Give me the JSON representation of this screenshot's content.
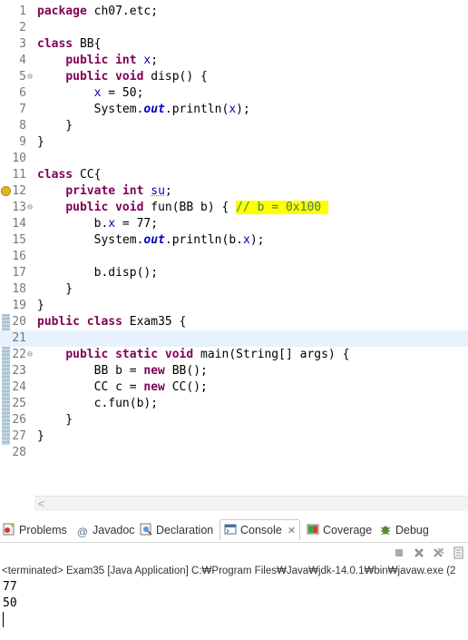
{
  "editor": {
    "lines": [
      {
        "n": "1",
        "tokens": [
          {
            "t": "package",
            "c": "kw"
          },
          {
            "t": " ch07.etc;",
            "c": ""
          }
        ]
      },
      {
        "n": "2",
        "tokens": []
      },
      {
        "n": "3",
        "tokens": [
          {
            "t": "class",
            "c": "kw"
          },
          {
            "t": " BB{",
            "c": ""
          }
        ]
      },
      {
        "n": "4",
        "tokens": [
          {
            "t": "    ",
            "c": ""
          },
          {
            "t": "public",
            "c": "kw"
          },
          {
            "t": " ",
            "c": ""
          },
          {
            "t": "int",
            "c": "kw"
          },
          {
            "t": " ",
            "c": ""
          },
          {
            "t": "x",
            "c": "fld"
          },
          {
            "t": ";",
            "c": ""
          }
        ]
      },
      {
        "n": "5",
        "fold": true,
        "tokens": [
          {
            "t": "    ",
            "c": ""
          },
          {
            "t": "public",
            "c": "kw"
          },
          {
            "t": " ",
            "c": ""
          },
          {
            "t": "void",
            "c": "kw"
          },
          {
            "t": " disp() {",
            "c": ""
          }
        ]
      },
      {
        "n": "6",
        "tokens": [
          {
            "t": "        ",
            "c": ""
          },
          {
            "t": "x",
            "c": "fld"
          },
          {
            "t": " = 50;",
            "c": ""
          }
        ]
      },
      {
        "n": "7",
        "tokens": [
          {
            "t": "        System.",
            "c": ""
          },
          {
            "t": "out",
            "c": "sfld"
          },
          {
            "t": ".println(",
            "c": ""
          },
          {
            "t": "x",
            "c": "fld"
          },
          {
            "t": ");",
            "c": ""
          }
        ]
      },
      {
        "n": "8",
        "tokens": [
          {
            "t": "    }",
            "c": ""
          }
        ]
      },
      {
        "n": "9",
        "tokens": [
          {
            "t": "}",
            "c": ""
          }
        ]
      },
      {
        "n": "10",
        "tokens": []
      },
      {
        "n": "11",
        "tokens": [
          {
            "t": "class",
            "c": "kw"
          },
          {
            "t": " CC{",
            "c": ""
          }
        ]
      },
      {
        "n": "12",
        "warn": true,
        "tokens": [
          {
            "t": "    ",
            "c": ""
          },
          {
            "t": "private",
            "c": "kw"
          },
          {
            "t": " ",
            "c": ""
          },
          {
            "t": "int",
            "c": "kw"
          },
          {
            "t": " ",
            "c": ""
          },
          {
            "t": "su",
            "c": "fld unused"
          },
          {
            "t": ";",
            "c": ""
          }
        ]
      },
      {
        "n": "13",
        "fold": true,
        "tokens": [
          {
            "t": "    ",
            "c": ""
          },
          {
            "t": "public",
            "c": "kw"
          },
          {
            "t": " ",
            "c": ""
          },
          {
            "t": "void",
            "c": "kw"
          },
          {
            "t": " fun(BB b) { ",
            "c": ""
          },
          {
            "t": "// b = 0x100 ",
            "c": "cmt"
          }
        ]
      },
      {
        "n": "14",
        "tokens": [
          {
            "t": "        b.",
            "c": ""
          },
          {
            "t": "x",
            "c": "fld"
          },
          {
            "t": " = 77;",
            "c": ""
          }
        ]
      },
      {
        "n": "15",
        "tokens": [
          {
            "t": "        System.",
            "c": ""
          },
          {
            "t": "out",
            "c": "sfld"
          },
          {
            "t": ".println(b.",
            "c": ""
          },
          {
            "t": "x",
            "c": "fld"
          },
          {
            "t": ");",
            "c": ""
          }
        ]
      },
      {
        "n": "16",
        "tokens": []
      },
      {
        "n": "17",
        "tokens": [
          {
            "t": "        b.disp();",
            "c": ""
          }
        ]
      },
      {
        "n": "18",
        "tokens": [
          {
            "t": "    }",
            "c": ""
          }
        ]
      },
      {
        "n": "19",
        "tokens": [
          {
            "t": "}",
            "c": ""
          }
        ]
      },
      {
        "n": "20",
        "tokens": [
          {
            "t": "public",
            "c": "kw"
          },
          {
            "t": " ",
            "c": ""
          },
          {
            "t": "class",
            "c": "kw"
          },
          {
            "t": " Exam35 {",
            "c": ""
          }
        ]
      },
      {
        "n": "21",
        "current": true,
        "tokens": []
      },
      {
        "n": "22",
        "fold": true,
        "tokens": [
          {
            "t": "    ",
            "c": ""
          },
          {
            "t": "public",
            "c": "kw"
          },
          {
            "t": " ",
            "c": ""
          },
          {
            "t": "static",
            "c": "kw"
          },
          {
            "t": " ",
            "c": ""
          },
          {
            "t": "void",
            "c": "kw"
          },
          {
            "t": " main(String[] args) {",
            "c": ""
          }
        ]
      },
      {
        "n": "23",
        "tokens": [
          {
            "t": "        BB b = ",
            "c": ""
          },
          {
            "t": "new",
            "c": "kw"
          },
          {
            "t": " BB();",
            "c": ""
          }
        ]
      },
      {
        "n": "24",
        "tokens": [
          {
            "t": "        CC c = ",
            "c": ""
          },
          {
            "t": "new",
            "c": "kw"
          },
          {
            "t": " CC();",
            "c": ""
          }
        ]
      },
      {
        "n": "25",
        "tokens": [
          {
            "t": "        c.fun(b);",
            "c": ""
          }
        ]
      },
      {
        "n": "26",
        "tokens": [
          {
            "t": "    }",
            "c": ""
          }
        ]
      },
      {
        "n": "27",
        "tokens": [
          {
            "t": "}",
            "c": ""
          }
        ]
      },
      {
        "n": "28",
        "tokens": []
      }
    ],
    "scroll_left": "<"
  },
  "tabs": {
    "problems": "Problems",
    "javadoc": "Javadoc",
    "declaration": "Declaration",
    "console": "Console",
    "coverage": "Coverage",
    "debug": "Debug",
    "at_symbol": "@"
  },
  "console": {
    "header": "<terminated> Exam35 [Java Application] C:₩Program Files₩Java₩jdk-14.0.1₩bin₩javaw.exe  (2",
    "output": [
      "77",
      "50"
    ]
  },
  "icons": {
    "problems": "problems-icon",
    "javadoc": "javadoc-icon",
    "declaration": "declaration-icon",
    "console": "console-icon",
    "coverage": "coverage-icon",
    "debug": "debug-icon"
  },
  "colors": {
    "keyword": "#7f0055",
    "field": "#0000c0",
    "comment": "#3f7f5f",
    "highlight": "#ffff00",
    "current_line": "#e8f2fe"
  }
}
